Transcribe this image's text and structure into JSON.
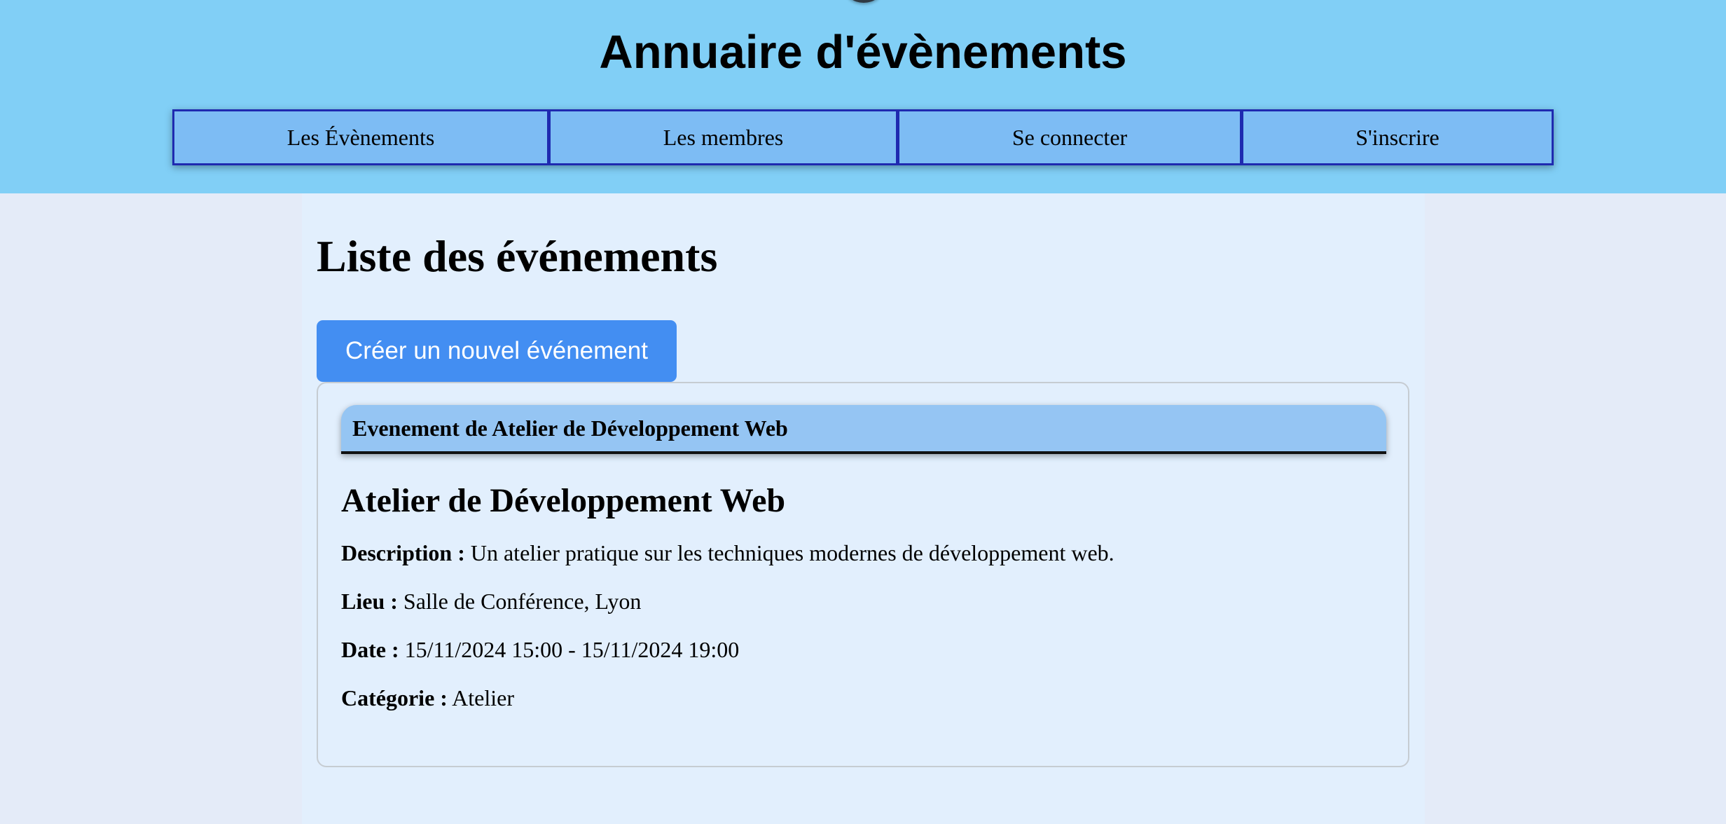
{
  "header": {
    "title": "Annuaire d'évènements",
    "nav": [
      {
        "label": "Les Évènements"
      },
      {
        "label": "Les membres"
      },
      {
        "label": "Se connecter"
      },
      {
        "label": "S'inscrire"
      }
    ]
  },
  "main": {
    "page_title": "Liste des événements",
    "create_button_label": "Créer un nouvel événement",
    "event": {
      "header": "Evenement de Atelier de Développement Web",
      "name": "Atelier de Développement Web",
      "description_label": "Description :",
      "description_value": "Un atelier pratique sur les techniques modernes de développement web.",
      "location_label": "Lieu :",
      "location_value": "Salle de Conférence, Lyon",
      "date_label": "Date :",
      "date_value": "15/11/2024 15:00 - 15/11/2024 19:00",
      "category_label": "Catégorie :",
      "category_value": "Atelier"
    }
  },
  "colors": {
    "header_bg": "#81cff6",
    "nav_bg": "#7dbcf4",
    "nav_border": "#1f2ab0",
    "page_bg": "#e4ebf8",
    "content_bg": "#e2effd",
    "button_bg": "#438ef2",
    "card_header_bg": "#95c5f3"
  }
}
